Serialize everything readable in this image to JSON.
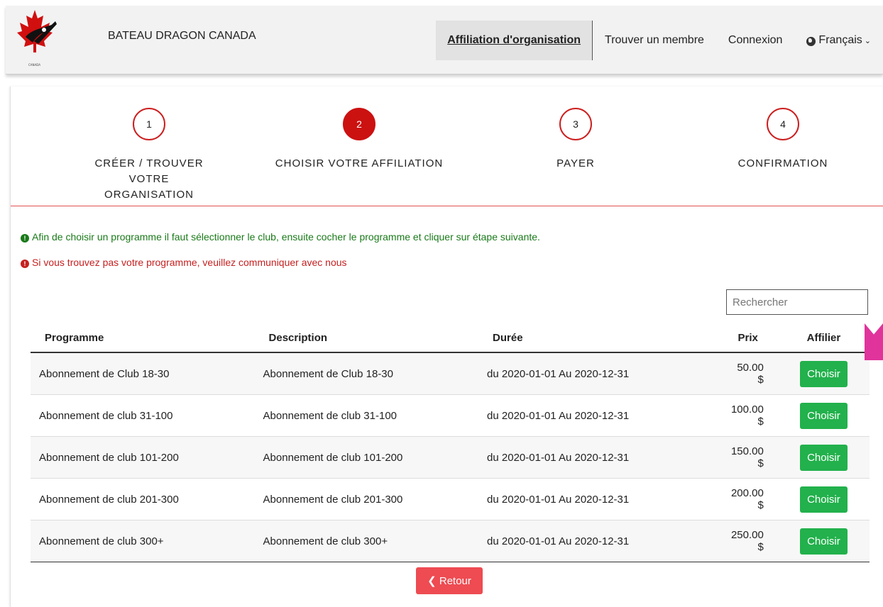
{
  "header": {
    "brand": "BATEAU DRAGON CANADA",
    "nav": {
      "affiliation": "Affiliation d'organisation",
      "find_member": "Trouver un membre",
      "login": "Connexion",
      "language": "Français"
    }
  },
  "steps": [
    {
      "number": "1",
      "label": "CRÉER / TROUVER VOTRE ORGANISATION"
    },
    {
      "number": "2",
      "label": "CHOISIR VOTRE AFFILIATION"
    },
    {
      "number": "3",
      "label": "PAYER"
    },
    {
      "number": "4",
      "label": "CONFIRMATION"
    }
  ],
  "messages": {
    "info": "Afin de choisir un programme il faut sélectionner le club, ensuite cocher le programme et cliquer sur étape suivante.",
    "warning": "Si vous trouvez pas votre programme, veuillez communiquer avec nous"
  },
  "search": {
    "placeholder": "Rechercher"
  },
  "table": {
    "headers": {
      "program": "Programme",
      "description": "Description",
      "duration": "Durée",
      "price": "Prix",
      "affiliate": "Affilier"
    },
    "rows": [
      {
        "program": "Abonnement de Club 18-30",
        "description": "Abonnement de Club 18-30",
        "duration": "du 2020-01-01 Au 2020-12-31",
        "price": "50.00 $",
        "action": "Choisir"
      },
      {
        "program": "Abonnement de club 31-100",
        "description": "Abonnement de club 31-100",
        "duration": "du 2020-01-01 Au 2020-12-31",
        "price": "100.00 $",
        "action": "Choisir"
      },
      {
        "program": "Abonnement de club 101-200",
        "description": "Abonnement de club 101-200",
        "duration": "du 2020-01-01 Au 2020-12-31",
        "price": "150.00 $",
        "action": "Choisir"
      },
      {
        "program": "Abonnement de club 201-300",
        "description": "Abonnement de club 201-300",
        "duration": "du 2020-01-01 Au 2020-12-31",
        "price": "200.00 $",
        "action": "Choisir"
      },
      {
        "program": "Abonnement de club 300+",
        "description": "Abonnement de club 300+",
        "duration": "du 2020-01-01 Au 2020-12-31",
        "price": "250.00 $",
        "action": "Choisir"
      }
    ]
  },
  "back_button": "Retour",
  "colors": {
    "accent_red": "#cc1111",
    "success_green": "#22b14c",
    "back_red": "#ee4b52"
  }
}
